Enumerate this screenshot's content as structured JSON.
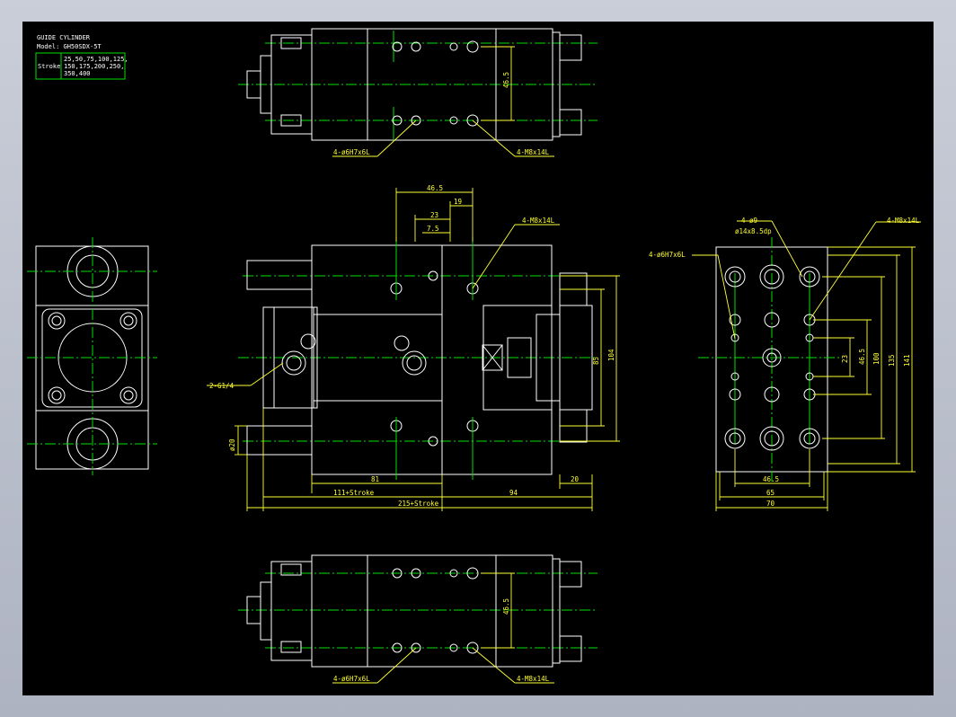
{
  "title_block": {
    "title": "GUIDE CYLINDER",
    "model": "Model: GH50SDX-5T",
    "stroke_label": "Stroke",
    "stroke_line1": "25,50,75,100,125,",
    "stroke_line2": "150,175,200,250,",
    "stroke_line3": "350,400"
  },
  "callouts": {
    "pin_hole": "4-ø6H7x6L",
    "tap_hole": "4-M8x14L",
    "port": "2-G1/4",
    "through_hole": "4-ø9",
    "counterbore": "ø14x8.5dp"
  },
  "dims": {
    "d46_5": "46.5",
    "d19": "19",
    "d23": "23",
    "d7_5": "7.5",
    "d85": "85",
    "d104": "104",
    "d20phi": "ø20",
    "d81": "81",
    "d20": "20",
    "d111": "111+Stroke",
    "d94": "94",
    "d215": "215+Stroke",
    "d100": "100",
    "d135": "135",
    "d141": "141",
    "d65": "65",
    "d70": "70"
  },
  "colors": {
    "outline": "#ffffff",
    "centerline": "#00e000",
    "dimension": "#ffff33",
    "background": "#000000"
  }
}
